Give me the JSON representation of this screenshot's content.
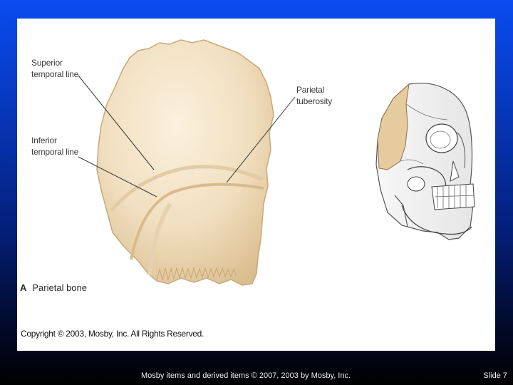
{
  "labels": {
    "superior_temporal_line": [
      "Superior",
      "temporal line"
    ],
    "inferior_temporal_line": [
      "Inferior",
      "temporal line"
    ],
    "parietal_tuberosity": [
      "Parietal",
      "tuberosity"
    ]
  },
  "caption": {
    "letter": "A",
    "text": "Parietal bone"
  },
  "copyright": "Copyright © 2003, Mosby, Inc. All Rights Reserved.",
  "footer": "Mosby items and derived items © 2007, 2003 by Mosby, Inc.",
  "slide_number": "Slide 7",
  "colors": {
    "bone": "#f1dfc0",
    "bone_shadow": "#d9bf93",
    "leader_line": "#333333",
    "background_top": "#0a4cf0",
    "background_bottom": "#000000"
  }
}
